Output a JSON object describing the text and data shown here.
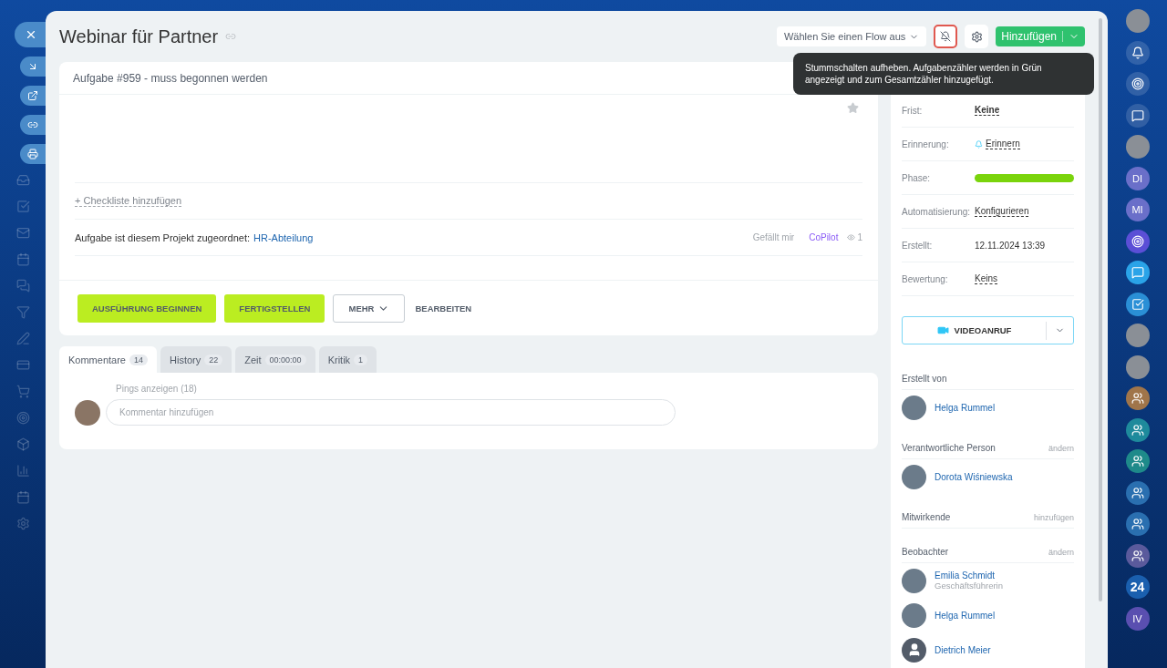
{
  "title": "Webinar für Partner",
  "header": {
    "flow_select": "Wählen Sie einen Flow aus",
    "add_button": "Hinzufügen"
  },
  "tooltip": "Stummschalten aufheben. Aufgabenzähler werden in Grün angezeigt und zum Gesamtzähler hinzugefügt.",
  "task": {
    "status": "Aufgabe #959 - muss begonnen werden",
    "checklist_link": "+ Checkliste hinzufügen",
    "project_label": "Aufgabe ist diesem Projekt zugeordnet:",
    "project": "HR-Abteilung",
    "like": "Gefällt mir",
    "copilot": "CoPilot",
    "views": "1"
  },
  "actions": [
    {
      "label": "AUSFÜHRUNG BEGINNEN",
      "kind": "primary"
    },
    {
      "label": "FERTIGSTELLEN",
      "kind": "primary"
    },
    {
      "label": "MEHR",
      "kind": "dropdown"
    },
    {
      "label": "BEARBEITEN",
      "kind": "text"
    }
  ],
  "tabs": [
    {
      "label": "Kommentare",
      "count": "14",
      "selected": true
    },
    {
      "label": "History",
      "count": "22",
      "selected": false
    },
    {
      "label": "Zeit",
      "count": "00:00:00",
      "selected": false
    },
    {
      "label": "Kritik",
      "count": "1",
      "selected": false
    }
  ],
  "comments": {
    "pings": "Pings anzeigen (18)",
    "placeholder": "Kommentar hinzufügen"
  },
  "details": [
    {
      "label": "Frist:",
      "value": "Keine",
      "kind": "bold-link"
    },
    {
      "label": "Erinnerung:",
      "value": "Erinnern",
      "kind": "reminder"
    },
    {
      "label": "Phase:",
      "kind": "phase"
    },
    {
      "label": "Automatisierung:",
      "value": "Konfigurieren",
      "kind": "link"
    },
    {
      "label": "Erstellt:",
      "value": "12.11.2024 13:39",
      "kind": "text"
    },
    {
      "label": "Bewertung:",
      "value": "Keins",
      "kind": "link"
    }
  ],
  "video_button": "VIDEOANRUF",
  "people_sections": [
    {
      "title": "Erstellt von",
      "people": [
        {
          "name": "Helga Rummel",
          "kind": "photo"
        }
      ]
    },
    {
      "title": "Verantwortliche Person",
      "action": "ändern",
      "people": [
        {
          "name": "Dorota Wiśniewska",
          "kind": "photo"
        }
      ]
    },
    {
      "title": "Mitwirkende",
      "action": "hinzufügen"
    },
    {
      "title": "Beobachter",
      "action": "ändern",
      "people": [
        {
          "name": "Emilia Schmidt",
          "subtitle": "Geschäftsführerin",
          "kind": "photo"
        },
        {
          "name": "Helga Rummel",
          "kind": "photo"
        },
        {
          "name": "Dietrich Meier",
          "kind": "generic"
        }
      ]
    }
  ],
  "right_rail": [
    {
      "kind": "photo"
    },
    {
      "kind": "bell"
    },
    {
      "kind": "target"
    },
    {
      "kind": "chat"
    },
    {
      "kind": "photo"
    },
    {
      "kind": "initials",
      "text": "DI",
      "color": "#6a6fc9"
    },
    {
      "kind": "initials",
      "text": "MI",
      "color": "#6a6fc9"
    },
    {
      "kind": "target",
      "color": "#5b4fd6"
    },
    {
      "kind": "chat",
      "color": "#2aa3e8"
    },
    {
      "kind": "task",
      "color": "#2a8fd6"
    },
    {
      "kind": "photo"
    },
    {
      "kind": "photo"
    },
    {
      "kind": "group",
      "color": "#a0754a"
    },
    {
      "kind": "group",
      "color": "#1e8a9c"
    },
    {
      "kind": "group",
      "color": "#1e8a8a"
    },
    {
      "kind": "group",
      "color": "#2a6fb0"
    },
    {
      "kind": "group",
      "color": "#2a6fb0"
    },
    {
      "kind": "group",
      "color": "#5a5a9c"
    },
    {
      "kind": "counter",
      "text": "24",
      "color": "#1a5fae"
    },
    {
      "kind": "initials",
      "text": "IV",
      "color": "#5a4fb0"
    }
  ]
}
